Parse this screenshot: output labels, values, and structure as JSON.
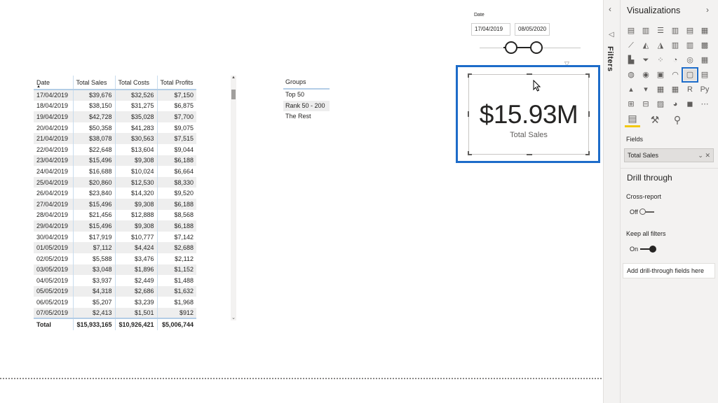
{
  "table": {
    "columns": [
      "Date",
      "Total Sales",
      "Total Costs",
      "Total Profits"
    ],
    "rows": [
      [
        "17/04/2019",
        "$39,676",
        "$32,526",
        "$7,150"
      ],
      [
        "18/04/2019",
        "$38,150",
        "$31,275",
        "$6,875"
      ],
      [
        "19/04/2019",
        "$42,728",
        "$35,028",
        "$7,700"
      ],
      [
        "20/04/2019",
        "$50,358",
        "$41,283",
        "$9,075"
      ],
      [
        "21/04/2019",
        "$38,078",
        "$30,563",
        "$7,515"
      ],
      [
        "22/04/2019",
        "$22,648",
        "$13,604",
        "$9,044"
      ],
      [
        "23/04/2019",
        "$15,496",
        "$9,308",
        "$6,188"
      ],
      [
        "24/04/2019",
        "$16,688",
        "$10,024",
        "$6,664"
      ],
      [
        "25/04/2019",
        "$20,860",
        "$12,530",
        "$8,330"
      ],
      [
        "26/04/2019",
        "$23,840",
        "$14,320",
        "$9,520"
      ],
      [
        "27/04/2019",
        "$15,496",
        "$9,308",
        "$6,188"
      ],
      [
        "28/04/2019",
        "$21,456",
        "$12,888",
        "$8,568"
      ],
      [
        "29/04/2019",
        "$15,496",
        "$9,308",
        "$6,188"
      ],
      [
        "30/04/2019",
        "$17,919",
        "$10,777",
        "$7,142"
      ],
      [
        "01/05/2019",
        "$7,112",
        "$4,424",
        "$2,688"
      ],
      [
        "02/05/2019",
        "$5,588",
        "$3,476",
        "$2,112"
      ],
      [
        "03/05/2019",
        "$3,048",
        "$1,896",
        "$1,152"
      ],
      [
        "04/05/2019",
        "$3,937",
        "$2,449",
        "$1,488"
      ],
      [
        "05/05/2019",
        "$4,318",
        "$2,686",
        "$1,632"
      ],
      [
        "06/05/2019",
        "$5,207",
        "$3,239",
        "$1,968"
      ],
      [
        "07/05/2019",
        "$2,413",
        "$1,501",
        "$912"
      ]
    ],
    "total": [
      "Total",
      "$15,933,165",
      "$10,926,421",
      "$5,006,744"
    ]
  },
  "groups": {
    "header": "Groups",
    "items": [
      "Top 50",
      "Rank 50 - 200",
      "The Rest"
    ]
  },
  "date_slicer": {
    "label": "Date",
    "start": "17/04/2019",
    "end": "08/05/2020"
  },
  "card": {
    "value": "$15.93M",
    "label": "Total Sales"
  },
  "filters_pane": {
    "label": "Filters",
    "collapse_icon": "‹"
  },
  "viz_pane": {
    "title": "Visualizations",
    "expand_icon": "›",
    "icons": [
      {
        "name": "stacked-bar-chart-icon",
        "glyph": "▤"
      },
      {
        "name": "stacked-column-chart-icon",
        "glyph": "▥"
      },
      {
        "name": "clustered-bar-chart-icon",
        "glyph": "☰"
      },
      {
        "name": "clustered-column-chart-icon",
        "glyph": "▥"
      },
      {
        "name": "100-bar-chart-icon",
        "glyph": "▤"
      },
      {
        "name": "100-column-chart-icon",
        "glyph": "▦"
      },
      {
        "name": "line-chart-icon",
        "glyph": "⟋"
      },
      {
        "name": "area-chart-icon",
        "glyph": "◭"
      },
      {
        "name": "stacked-area-chart-icon",
        "glyph": "◮"
      },
      {
        "name": "line-column-chart-icon",
        "glyph": "▥"
      },
      {
        "name": "line-stacked-column-chart-icon",
        "glyph": "▥"
      },
      {
        "name": "ribbon-chart-icon",
        "glyph": "▩"
      },
      {
        "name": "waterfall-chart-icon",
        "glyph": "▙"
      },
      {
        "name": "funnel-chart-icon",
        "glyph": "⏷"
      },
      {
        "name": "scatter-chart-icon",
        "glyph": "⁘"
      },
      {
        "name": "pie-chart-icon",
        "glyph": "◔"
      },
      {
        "name": "donut-chart-icon",
        "glyph": "◎"
      },
      {
        "name": "treemap-icon",
        "glyph": "▦"
      },
      {
        "name": "map-icon",
        "glyph": "◍"
      },
      {
        "name": "filled-map-icon",
        "glyph": "◉"
      },
      {
        "name": "shape-map-icon",
        "glyph": "▣"
      },
      {
        "name": "gauge-icon",
        "glyph": "◠"
      },
      {
        "name": "card-icon",
        "glyph": "▢"
      },
      {
        "name": "multi-row-card-icon",
        "glyph": "▤"
      },
      {
        "name": "kpi-icon",
        "glyph": "▴"
      },
      {
        "name": "slicer-icon",
        "glyph": "▾"
      },
      {
        "name": "table-icon",
        "glyph": "▦"
      },
      {
        "name": "matrix-icon",
        "glyph": "▦"
      },
      {
        "name": "r-visual-icon",
        "glyph": "R"
      },
      {
        "name": "python-visual-icon",
        "glyph": "Py"
      },
      {
        "name": "key-influencers-icon",
        "glyph": "⊞"
      },
      {
        "name": "decomposition-tree-icon",
        "glyph": "⊟"
      },
      {
        "name": "qa-icon",
        "glyph": "▨"
      },
      {
        "name": "arcgis-icon",
        "glyph": "◕"
      },
      {
        "name": "power-apps-icon",
        "glyph": "◼"
      },
      {
        "name": "more-visuals-icon",
        "glyph": "⋯"
      }
    ],
    "tabs": [
      {
        "name": "fields-tab-icon",
        "glyph": "▤"
      },
      {
        "name": "format-paint-roller-icon",
        "glyph": "⚒"
      },
      {
        "name": "analytics-magnifier-icon",
        "glyph": "⚲"
      }
    ],
    "fields_label": "Fields",
    "field_well_value": "Total Sales",
    "field_well_actions": "⌄ ✕",
    "drill_title": "Drill through",
    "cross_report_label": "Cross-report",
    "cross_report_state": "Off",
    "keep_filters_label": "Keep all filters",
    "keep_filters_state": "On",
    "drill_field_placeholder": "Add drill-through fields here"
  }
}
